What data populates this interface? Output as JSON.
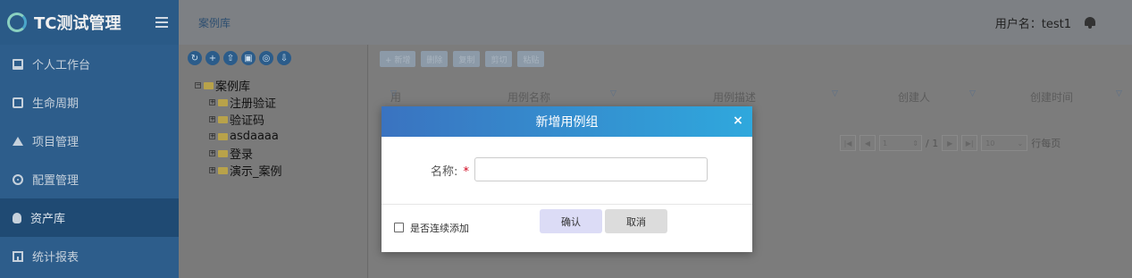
{
  "app": {
    "brand": "TC测试管理"
  },
  "sidebar": {
    "items": [
      {
        "label": "个人工作台",
        "icon": "monitor-icon"
      },
      {
        "label": "生命周期",
        "icon": "document-icon"
      },
      {
        "label": "项目管理",
        "icon": "layers-icon"
      },
      {
        "label": "配置管理",
        "icon": "gear-icon"
      },
      {
        "label": "资产库",
        "icon": "database-icon",
        "active": true
      },
      {
        "label": "统计报表",
        "icon": "chart-icon"
      }
    ]
  },
  "header": {
    "breadcrumb": "案例库",
    "user": "用户名：test1"
  },
  "tree": {
    "root": "案例库",
    "children": [
      "注册验证",
      "验证码",
      "asdaaaa",
      "登录",
      "演示_案例"
    ]
  },
  "toolbar": {
    "buttons": [
      "+ 新增",
      "删除",
      "复制",
      "剪切",
      "粘贴"
    ]
  },
  "table": {
    "columns": [
      "用例ID",
      "用例名称",
      "用例描述",
      "创建人",
      "创建时间"
    ]
  },
  "pager": {
    "page": "1",
    "total": "/ 1",
    "page_size": "10",
    "per_page_label": "行每页"
  },
  "modal": {
    "title": "新增用例组",
    "close": "×",
    "name_label": "名称:",
    "required_mark": "*",
    "name_value": "",
    "continue_label": "是否连续添加",
    "confirm": "确认",
    "cancel": "取消"
  }
}
